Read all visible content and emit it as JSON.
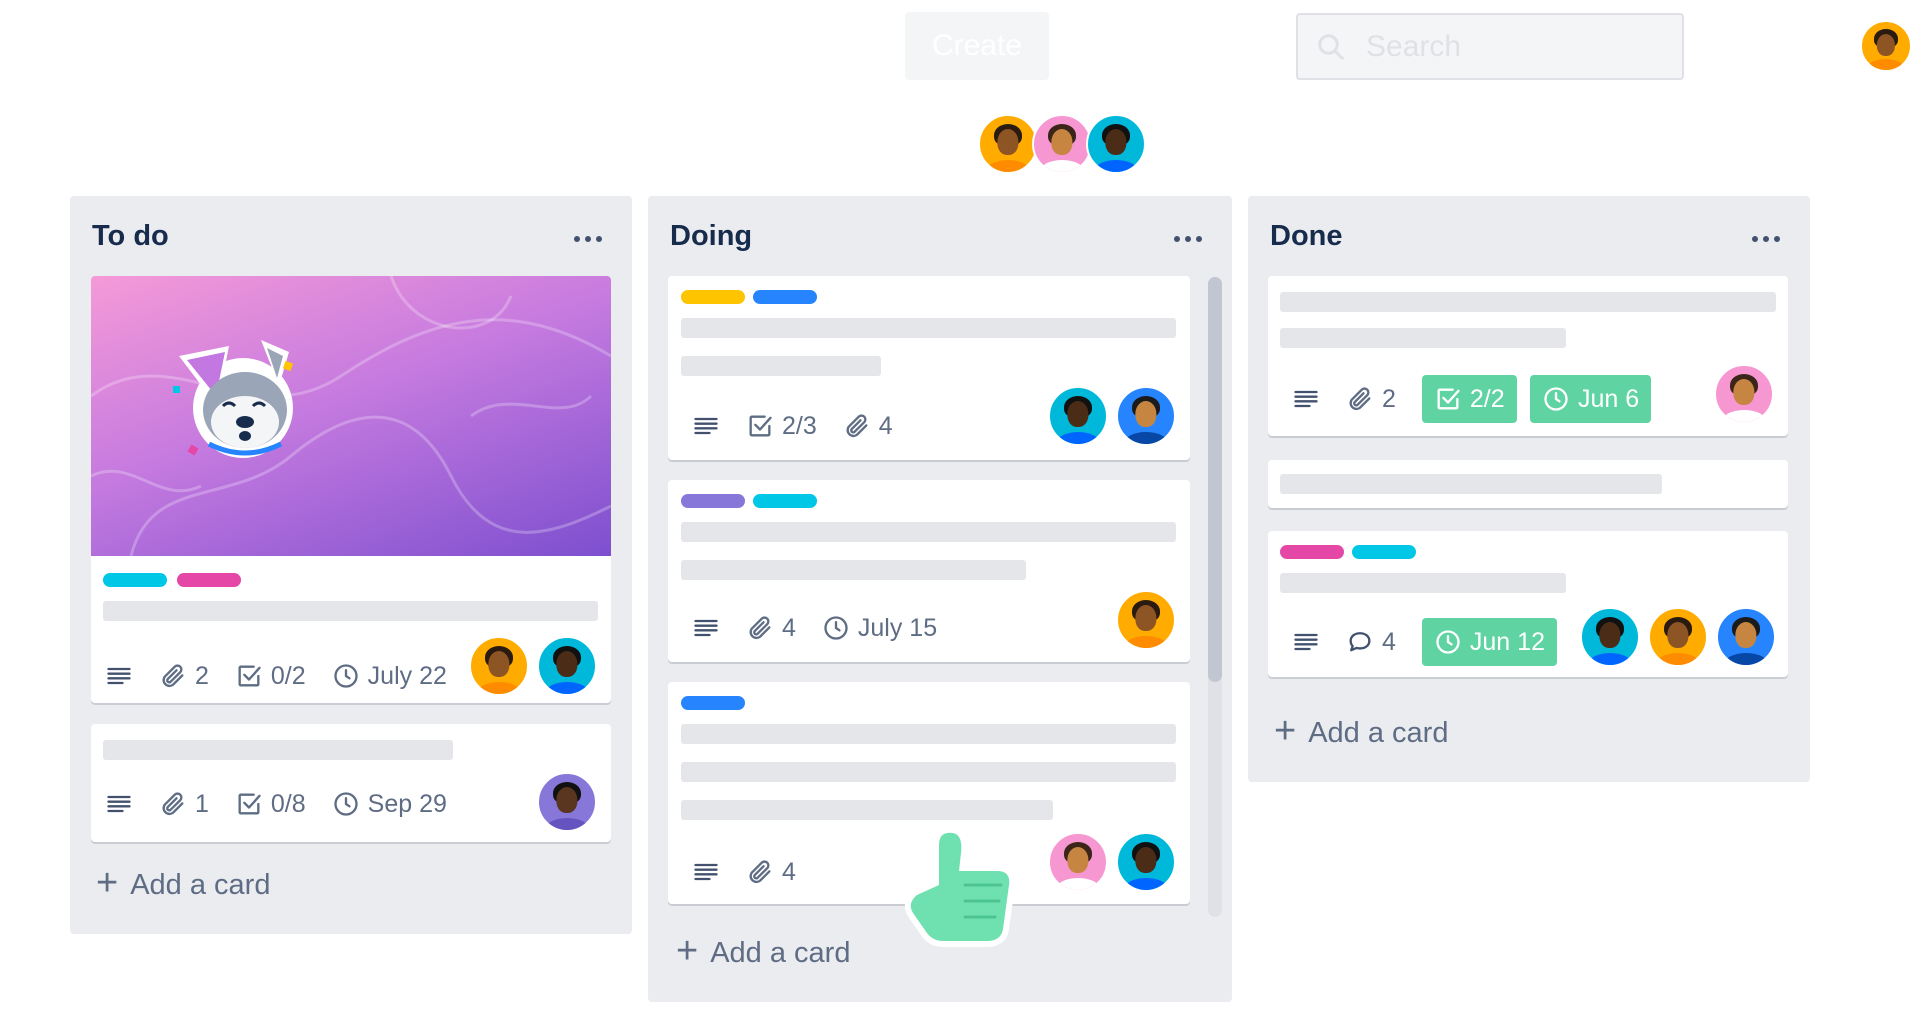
{
  "header": {
    "create_label": "Create",
    "search_placeholder": "Search"
  },
  "colors": {
    "list_bg": "#ebecf0",
    "green_badge": "#5fd3a1",
    "label_yellow": "#ffc400",
    "label_blue": "#2684ff",
    "label_cyan": "#00c7e6",
    "label_pink": "#e547a7",
    "label_purple": "#8777d9"
  },
  "lists": [
    {
      "title": "To do",
      "add_card_label": "Add a card",
      "cards": [
        {
          "attachments": "2",
          "checklist": "0/2",
          "due": "July 22"
        },
        {
          "attachments": "1",
          "checklist": "0/8",
          "due": "Sep 29"
        }
      ]
    },
    {
      "title": "Doing",
      "add_card_label": "Add a card",
      "cards": [
        {
          "checklist": "2/3",
          "attachments": "4"
        },
        {
          "attachments": "4",
          "due": "July 15"
        },
        {
          "attachments": "4"
        }
      ]
    },
    {
      "title": "Done",
      "add_card_label": "Add a card",
      "cards": [
        {
          "attachments": "2",
          "checklist": "2/2",
          "due": "Jun 6"
        },
        {},
        {
          "comments": "4",
          "due": "Jun 12"
        }
      ]
    }
  ],
  "icons": {
    "description": "description-lines-icon",
    "attachment": "paperclip-icon",
    "checklist": "checkbox-icon",
    "due": "clock-icon",
    "comment": "speech-bubble-icon",
    "menu": "more-dots-icon",
    "add": "plus-icon",
    "search": "search-icon"
  }
}
